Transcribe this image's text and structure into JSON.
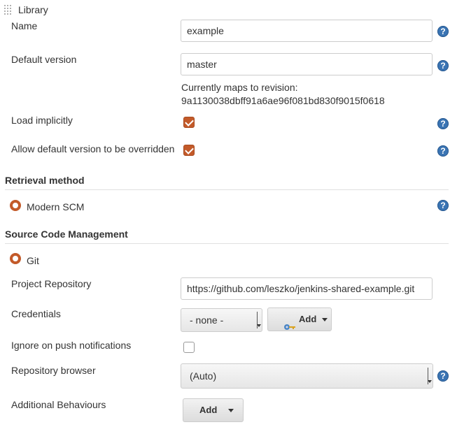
{
  "library": {
    "header": "Library",
    "name_label": "Name",
    "name_value": "example",
    "default_version_label": "Default version",
    "default_version_value": "master",
    "revision_line1": "Currently maps to revision:",
    "revision_hash": "9a1130038dbff91a6ae96f081bd830f9015f0618",
    "load_implicitly_label": "Load implicitly",
    "load_implicitly_checked": true,
    "allow_override_label": "Allow default version to be overridden",
    "allow_override_checked": true
  },
  "retrieval": {
    "title": "Retrieval method",
    "option_label": "Modern SCM"
  },
  "scm": {
    "title": "Source Code Management",
    "option_label": "Git",
    "project_repo_label": "Project Repository",
    "project_repo_value": "https://github.com/leszko/jenkins-shared-example.git",
    "credentials_label": "Credentials",
    "credentials_selected": "- none -",
    "credentials_add_label": "Add",
    "ignore_push_label": "Ignore on push notifications",
    "ignore_push_checked": false,
    "repo_browser_label": "Repository browser",
    "repo_browser_selected": "(Auto)",
    "additional_behaviours_label": "Additional Behaviours",
    "additional_add_label": "Add"
  },
  "help_glyph": "?",
  "colors": {
    "accent_orange": "#c35a29",
    "help_blue": "#3a74b3"
  }
}
